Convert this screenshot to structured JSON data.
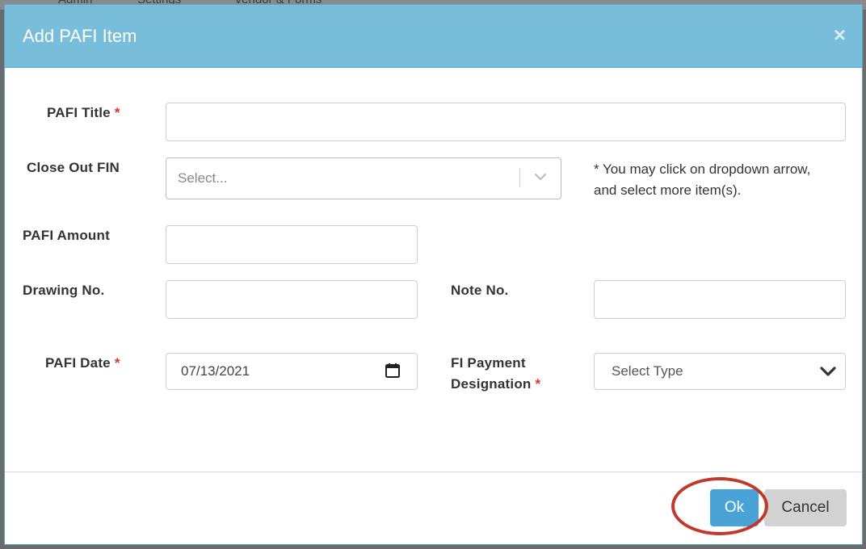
{
  "background_nav": {
    "items": [
      "Admin",
      "Settings",
      "Vendor & Forms"
    ]
  },
  "modal": {
    "title": "Add PAFI Item",
    "close_symbol": "×"
  },
  "form": {
    "pafi_title": {
      "label": "PAFI Title",
      "required_mark": "*",
      "value": ""
    },
    "close_out_fin": {
      "label": "Close Out FIN",
      "placeholder": "Select..."
    },
    "close_out_note": "* You may click on dropdown arrow, and select more item(s).",
    "pafi_amount": {
      "label": "PAFI Amount",
      "value": ""
    },
    "drawing_no": {
      "label": "Drawing No.",
      "value": ""
    },
    "note_no": {
      "label": "Note No.",
      "value": ""
    },
    "pafi_date": {
      "label": "PAFI Date",
      "required_mark": "*",
      "value": "07/13/2021"
    },
    "fi_payment_designation": {
      "label_line1": "FI Payment",
      "label_line2": "Designation",
      "required_mark": "*",
      "selected": "Select Type"
    }
  },
  "footer": {
    "ok_label": "Ok",
    "cancel_label": "Cancel"
  },
  "colors": {
    "header_bg": "#78bedb",
    "ok_bg": "#4aa3d6",
    "cancel_bg": "#d2d2d2",
    "required": "#d9342b",
    "highlight_ring": "#c0392b"
  },
  "icons": [
    "close-icon",
    "chevron-down-icon",
    "calendar-icon"
  ]
}
